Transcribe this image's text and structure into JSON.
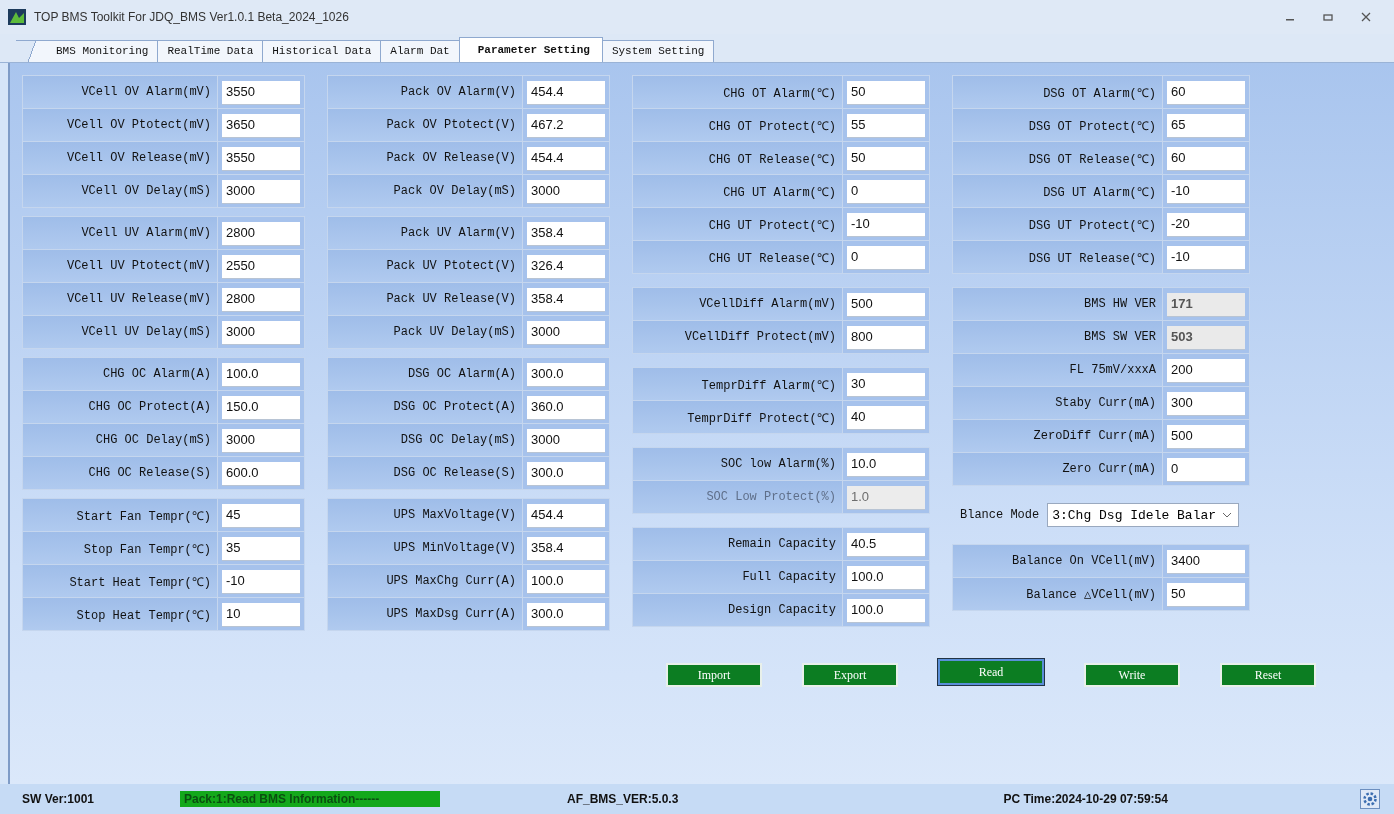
{
  "window": {
    "title": "TOP BMS Toolkit For JDQ_BMS Ver1.0.1 Beta_2024_1026"
  },
  "tabs": [
    {
      "label": "BMS Monitoring",
      "selected": false
    },
    {
      "label": "RealTime Data",
      "selected": false
    },
    {
      "label": "Historical Data",
      "selected": false
    },
    {
      "label": "Alarm Dat",
      "selected": false
    },
    {
      "label": "Parameter Setting",
      "selected": true
    },
    {
      "label": "System Setting",
      "selected": false
    }
  ],
  "columns": [
    {
      "blocks": [
        {
          "kind": "group",
          "rows": [
            {
              "label": "VCell OV Alarm(mV)",
              "value": "3550",
              "kind": "edit"
            },
            {
              "label": "VCell OV Ptotect(mV)",
              "value": "3650",
              "kind": "edit"
            },
            {
              "label": "VCell OV Release(mV)",
              "value": "3550",
              "kind": "edit"
            },
            {
              "label": "VCell OV Delay(mS)",
              "value": "3000",
              "kind": "edit"
            }
          ]
        },
        {
          "kind": "group",
          "rows": [
            {
              "label": "VCell UV Alarm(mV)",
              "value": "2800",
              "kind": "edit"
            },
            {
              "label": "VCell UV Ptotect(mV)",
              "value": "2550",
              "kind": "edit"
            },
            {
              "label": "VCell UV Release(mV)",
              "value": "2800",
              "kind": "edit"
            },
            {
              "label": "VCell UV Delay(mS)",
              "value": "3000",
              "kind": "edit"
            }
          ]
        },
        {
          "kind": "group",
          "rows": [
            {
              "label": "CHG OC Alarm(A)",
              "value": "100.0",
              "kind": "edit"
            },
            {
              "label": "CHG OC Protect(A)",
              "value": "150.0",
              "kind": "edit"
            },
            {
              "label": "CHG OC Delay(mS)",
              "value": "3000",
              "kind": "edit"
            },
            {
              "label": "CHG OC Release(S)",
              "value": "600.0",
              "kind": "edit"
            }
          ]
        },
        {
          "kind": "group",
          "rows": [
            {
              "label": "Start Fan Tempr(℃)",
              "value": "45",
              "kind": "edit"
            },
            {
              "label": "Stop Fan Tempr(℃)",
              "value": "35",
              "kind": "edit"
            },
            {
              "label": "Start Heat Tempr(℃)",
              "value": "-10",
              "kind": "edit"
            },
            {
              "label": "Stop Heat Tempr(℃)",
              "value": "10",
              "kind": "edit"
            }
          ]
        }
      ]
    },
    {
      "blocks": [
        {
          "kind": "group",
          "rows": [
            {
              "label": "Pack OV Alarm(V)",
              "value": "454.4",
              "kind": "edit"
            },
            {
              "label": "Pack OV Ptotect(V)",
              "value": "467.2",
              "kind": "edit"
            },
            {
              "label": "Pack OV Release(V)",
              "value": "454.4",
              "kind": "edit"
            },
            {
              "label": "Pack OV Delay(mS)",
              "value": "3000",
              "kind": "edit"
            }
          ]
        },
        {
          "kind": "group",
          "rows": [
            {
              "label": "Pack UV Alarm(V)",
              "value": "358.4",
              "kind": "edit"
            },
            {
              "label": "Pack UV Ptotect(V)",
              "value": "326.4",
              "kind": "edit"
            },
            {
              "label": "Pack UV Release(V)",
              "value": "358.4",
              "kind": "edit"
            },
            {
              "label": "Pack UV Delay(mS)",
              "value": "3000",
              "kind": "edit"
            }
          ]
        },
        {
          "kind": "group",
          "rows": [
            {
              "label": "DSG OC Alarm(A)",
              "value": "300.0",
              "kind": "edit"
            },
            {
              "label": "DSG OC Protect(A)",
              "value": "360.0",
              "kind": "edit"
            },
            {
              "label": "DSG OC Delay(mS)",
              "value": "3000",
              "kind": "edit"
            },
            {
              "label": "DSG OC Release(S)",
              "value": "300.0",
              "kind": "edit"
            }
          ]
        },
        {
          "kind": "group",
          "rows": [
            {
              "label": "UPS MaxVoltage(V)",
              "value": "454.4",
              "kind": "edit"
            },
            {
              "label": "UPS MinVoltage(V)",
              "value": "358.4",
              "kind": "edit"
            },
            {
              "label": "UPS MaxChg Curr(A)",
              "value": "100.0",
              "kind": "edit"
            },
            {
              "label": "UPS MaxDsg Curr(A)",
              "value": "300.0",
              "kind": "edit"
            }
          ]
        }
      ]
    },
    {
      "blocks": [
        {
          "kind": "group",
          "rows": [
            {
              "label": "CHG OT Alarm(℃)",
              "value": "50",
              "kind": "edit"
            },
            {
              "label": "CHG OT Protect(℃)",
              "value": "55",
              "kind": "edit"
            },
            {
              "label": "CHG OT Release(℃)",
              "value": "50",
              "kind": "edit"
            },
            {
              "label": "CHG UT Alarm(℃)",
              "value": "0",
              "kind": "edit"
            },
            {
              "label": "CHG UT Protect(℃)",
              "value": "-10",
              "kind": "edit"
            },
            {
              "label": "CHG UT Release(℃)",
              "value": "0",
              "kind": "edit"
            }
          ]
        },
        {
          "kind": "group",
          "rows": [
            {
              "label": "VCellDiff Alarm(mV)",
              "value": "500",
              "kind": "edit"
            },
            {
              "label": "VCellDiff Protect(mV)",
              "value": "800",
              "kind": "edit"
            }
          ]
        },
        {
          "kind": "group",
          "rows": [
            {
              "label": "TemprDiff Alarm(℃)",
              "value": "30",
              "kind": "edit"
            },
            {
              "label": "TemprDiff Protect(℃)",
              "value": "40",
              "kind": "edit"
            }
          ]
        },
        {
          "kind": "group",
          "rows": [
            {
              "label": "SOC low Alarm(%)",
              "value": "10.0",
              "kind": "edit"
            },
            {
              "label": "SOC Low Protect(%)",
              "value": "1.0",
              "kind": "disabled"
            }
          ]
        },
        {
          "kind": "group",
          "rows": [
            {
              "label": "Remain Capacity",
              "value": "40.5",
              "kind": "edit"
            },
            {
              "label": "Full Capacity",
              "value": "100.0",
              "kind": "edit"
            },
            {
              "label": "Design Capacity",
              "value": "100.0",
              "kind": "edit"
            }
          ]
        }
      ]
    },
    {
      "blocks": [
        {
          "kind": "group",
          "rows": [
            {
              "label": "DSG OT Alarm(℃)",
              "value": "60",
              "kind": "edit"
            },
            {
              "label": "DSG OT Protect(℃)",
              "value": "65",
              "kind": "edit"
            },
            {
              "label": "DSG OT Release(℃)",
              "value": "60",
              "kind": "edit"
            },
            {
              "label": "DSG UT Alarm(℃)",
              "value": "-10",
              "kind": "edit"
            },
            {
              "label": "DSG UT Protect(℃)",
              "value": "-20",
              "kind": "edit"
            },
            {
              "label": "DSG UT Release(℃)",
              "value": "-10",
              "kind": "edit"
            }
          ]
        },
        {
          "kind": "group",
          "rows": [
            {
              "label": "BMS HW VER",
              "value": "171",
              "kind": "readonly"
            },
            {
              "label": "BMS SW VER",
              "value": "503",
              "kind": "readonly"
            },
            {
              "label": "FL 75mV/xxxA",
              "value": "200",
              "kind": "edit"
            },
            {
              "label": "Staby Curr(mA)",
              "value": "300",
              "kind": "edit"
            },
            {
              "label": "ZeroDiff Curr(mA)",
              "value": "500",
              "kind": "edit"
            },
            {
              "label": "Zero Curr(mA)",
              "value": "0",
              "kind": "edit"
            }
          ]
        },
        {
          "kind": "select",
          "label": "Blance Mode",
          "value": "3:Chg Dsg Idele Balar"
        },
        {
          "kind": "group",
          "rows": [
            {
              "label": "Balance On VCell(mV)",
              "value": "3400",
              "kind": "edit"
            },
            {
              "label": "Balance △VCell(mV)",
              "value": "50",
              "kind": "edit"
            }
          ]
        }
      ]
    }
  ],
  "buttons": [
    {
      "label": "Import",
      "focused": false
    },
    {
      "label": "Export",
      "focused": false
    },
    {
      "label": "Read",
      "focused": true
    },
    {
      "label": "Write",
      "focused": false
    },
    {
      "label": "Reset",
      "focused": false
    }
  ],
  "status_bar": {
    "sw_version": "SW Ver:1001",
    "message": "Pack:1:Read BMS Information------",
    "af_version": "AF_BMS_VER:5.0.3",
    "pc_time": "PC Time:2024-10-29 07:59:54"
  }
}
